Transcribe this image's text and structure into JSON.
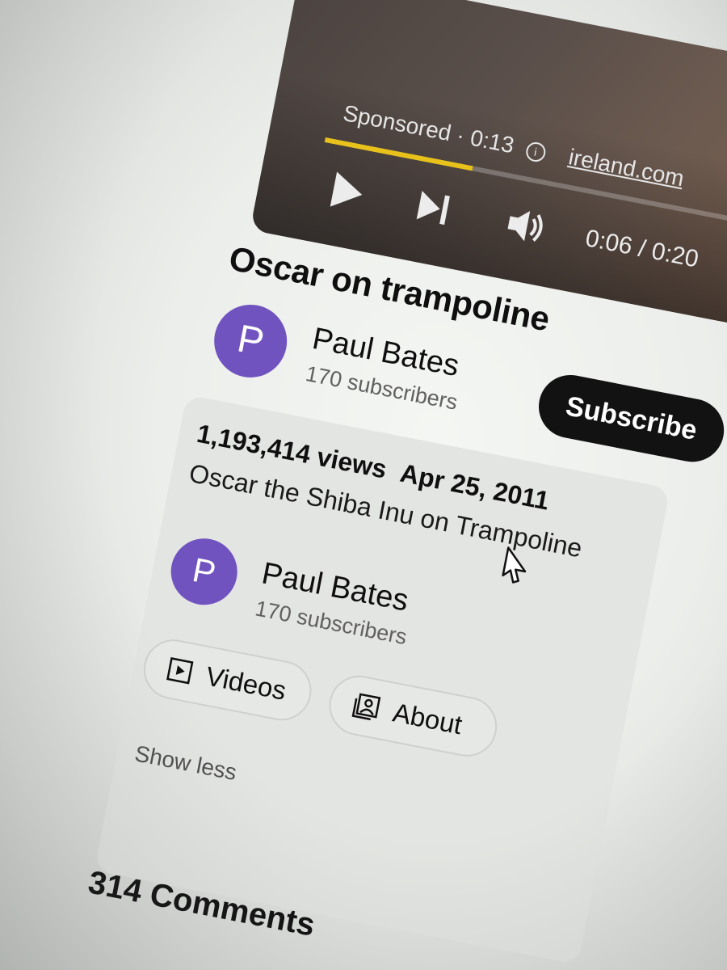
{
  "player": {
    "sponsored_label": "Sponsored",
    "separator": " · ",
    "ad_countdown": "0:13",
    "info_icon": "i",
    "ad_domain": "ireland.com",
    "progress_fraction": 0.3,
    "progress_color": "#e8c21a",
    "time_display": "0:06 / 0:20",
    "icons": [
      "play-icon",
      "next-icon",
      "volume-icon",
      "info-icon"
    ]
  },
  "video": {
    "title": "Oscar on trampoline"
  },
  "owner": {
    "avatar_letter": "P",
    "avatar_color": "#7153c0",
    "name": "Paul Bates",
    "subscribers": "170 subscribers",
    "subscribe_label": "Subscribe"
  },
  "description": {
    "views": "1,193,414 views",
    "date": "Apr 25, 2011",
    "text": "Oscar the Shiba Inu on Trampoline",
    "owner": {
      "avatar_letter": "P",
      "name": "Paul Bates",
      "subscribers": "170 subscribers"
    },
    "videos_label": "Videos",
    "about_label": "About",
    "show_less_label": "Show less"
  },
  "comments": {
    "label": "314 Comments"
  }
}
